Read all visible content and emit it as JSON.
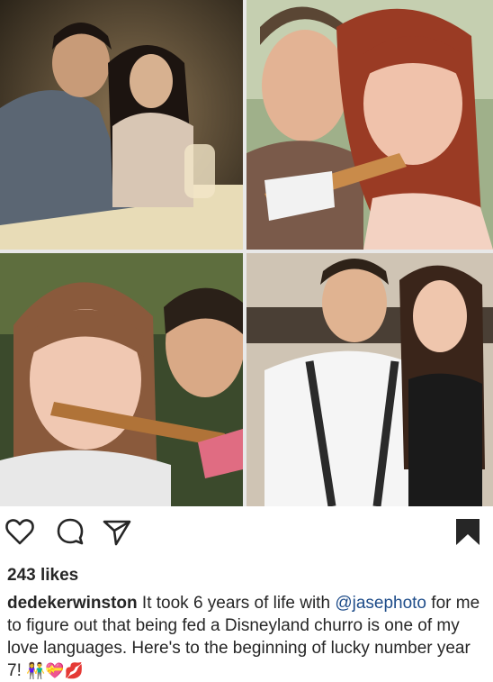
{
  "post": {
    "photos": [
      {
        "id": "p1",
        "alt": "couple at dinner table"
      },
      {
        "id": "p2",
        "alt": "couple sharing churro"
      },
      {
        "id": "p3",
        "alt": "woman eating churro with man"
      },
      {
        "id": "p4",
        "alt": "couple posing indoors"
      }
    ],
    "likes_count": "243",
    "likes_label": "likes",
    "caption": {
      "username": "dedekerwinston",
      "text_before_mention": " It took 6 years of life with ",
      "mention": "@jasephoto",
      "text_after_mention": " for me to figure out that being fed a Disneyland churro is one of my love languages. Here's to the beginning of lucky number year 7! ",
      "emojis": "👫💝💋"
    }
  },
  "icons": {
    "like": "heart-icon",
    "comment": "comment-icon",
    "share": "share-icon",
    "save": "bookmark-icon"
  },
  "colors": {
    "text": "#262626",
    "mention": "#1f4d8a",
    "icon": "#262626"
  }
}
